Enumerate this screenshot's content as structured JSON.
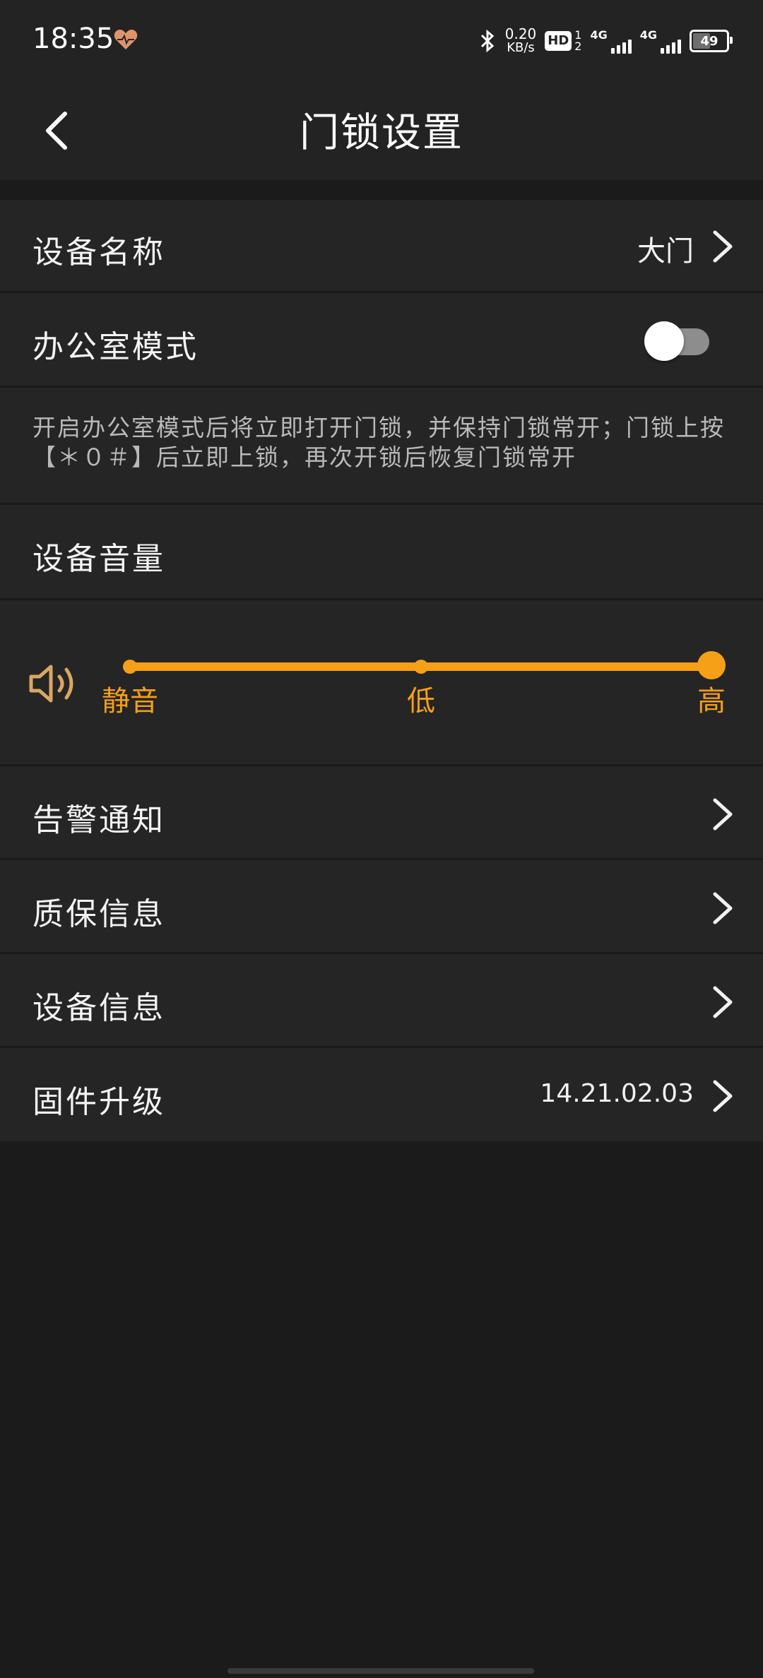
{
  "status_bar": {
    "time": "18:35",
    "health_icon": "heart-pulse-icon",
    "net_speed_value": "0.20",
    "net_speed_unit": "KB/s",
    "hd_label": "HD",
    "hd_sub_top": "1",
    "hd_sub_bottom": "2",
    "signal1_label": "4G",
    "signal2_label": "4G",
    "battery_level": "49"
  },
  "header": {
    "title": "门锁设置",
    "back_icon": "chevron-left-icon"
  },
  "settings": {
    "device_name": {
      "label": "设备名称",
      "value": "大门"
    },
    "office_mode": {
      "label": "办公室模式",
      "enabled": false,
      "description": "开启办公室模式后将立即打开门锁，并保持门锁常开；门锁上按【＊０＃】后立即上锁，再次开锁后恢复门锁常开"
    },
    "volume": {
      "label": "设备音量",
      "levels": [
        "静音",
        "低",
        "高"
      ],
      "selected_index": 2,
      "icon": "speaker-icon"
    },
    "alarm_notify": {
      "label": "告警通知"
    },
    "warranty_info": {
      "label": "质保信息"
    },
    "device_info": {
      "label": "设备信息"
    },
    "firmware": {
      "label": "固件升级",
      "value": "14.21.02.03"
    }
  },
  "colors": {
    "accent": "#f5a017",
    "background": "#1b1b1b",
    "row_background": "#252525"
  }
}
